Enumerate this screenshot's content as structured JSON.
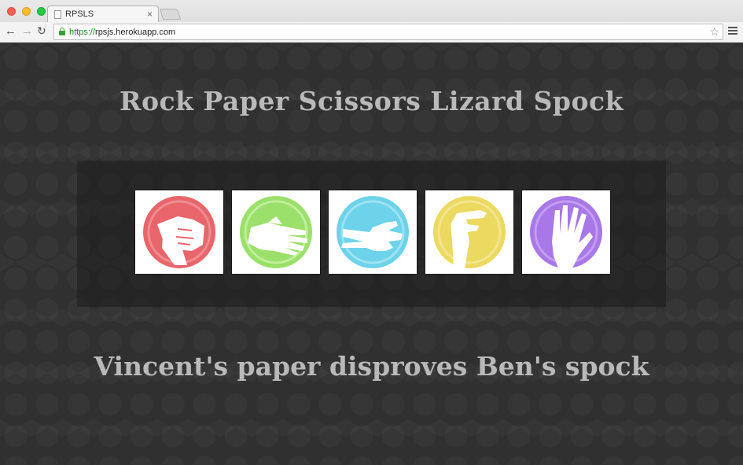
{
  "browser": {
    "tab_title": "RPSLS",
    "tab_close": "×",
    "url_scheme": "https://",
    "url_rest": "rpsjs.herokuapp.com",
    "back_glyph": "←",
    "forward_glyph": "→",
    "reload_glyph": "↻",
    "star_glyph": "☆"
  },
  "page": {
    "title": "Rock Paper Scissors Lizard Spock",
    "result": "Vincent's paper disproves Ben's spock",
    "choices": [
      {
        "name": "rock",
        "icon": "fist-icon",
        "color": "#e8666b"
      },
      {
        "name": "paper",
        "icon": "open-hand-icon",
        "color": "#9be06a"
      },
      {
        "name": "scissors",
        "icon": "peace-hand-icon",
        "color": "#6cd3ea"
      },
      {
        "name": "lizard",
        "icon": "lizard-hand-icon",
        "color": "#ecd95f"
      },
      {
        "name": "spock",
        "icon": "vulcan-salute-icon",
        "color": "#a877e8"
      }
    ]
  }
}
